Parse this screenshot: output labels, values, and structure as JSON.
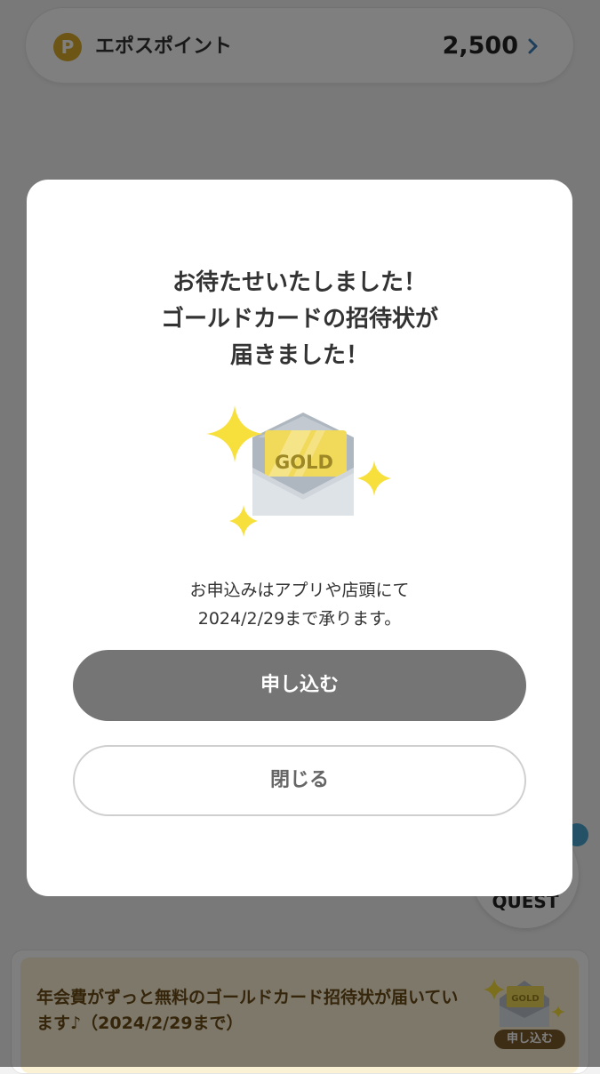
{
  "points": {
    "icon": "p-coin-icon",
    "coin_letter": "P",
    "label": "エポスポイント",
    "value": "2,500"
  },
  "quest": {
    "label": "QUEST"
  },
  "banner": {
    "text": "年会費がずっと無料のゴールドカード招待状が届いています♪（2024/2/29まで）",
    "illustration_text": "GOLD",
    "apply_label": "申し込む"
  },
  "dialog": {
    "title_lines": [
      "お待たせいたしました！",
      "ゴールドカードの招待状が",
      "届きました！"
    ],
    "illustration_text": "GOLD",
    "desc_lines": [
      "お申込みはアプリや店頭にて",
      "2024/2/29まで承ります。"
    ],
    "apply_label": "申し込む",
    "close_label": "閉じる"
  },
  "colors": {
    "overlay": "#000000",
    "primary_button": "#757575",
    "gold": "#f1d95a",
    "sparkle": "#f7df3c",
    "banner_bg": "#fbf1d4",
    "coin": "#d9ab2a",
    "quest_dot": "#4aa3cf"
  }
}
